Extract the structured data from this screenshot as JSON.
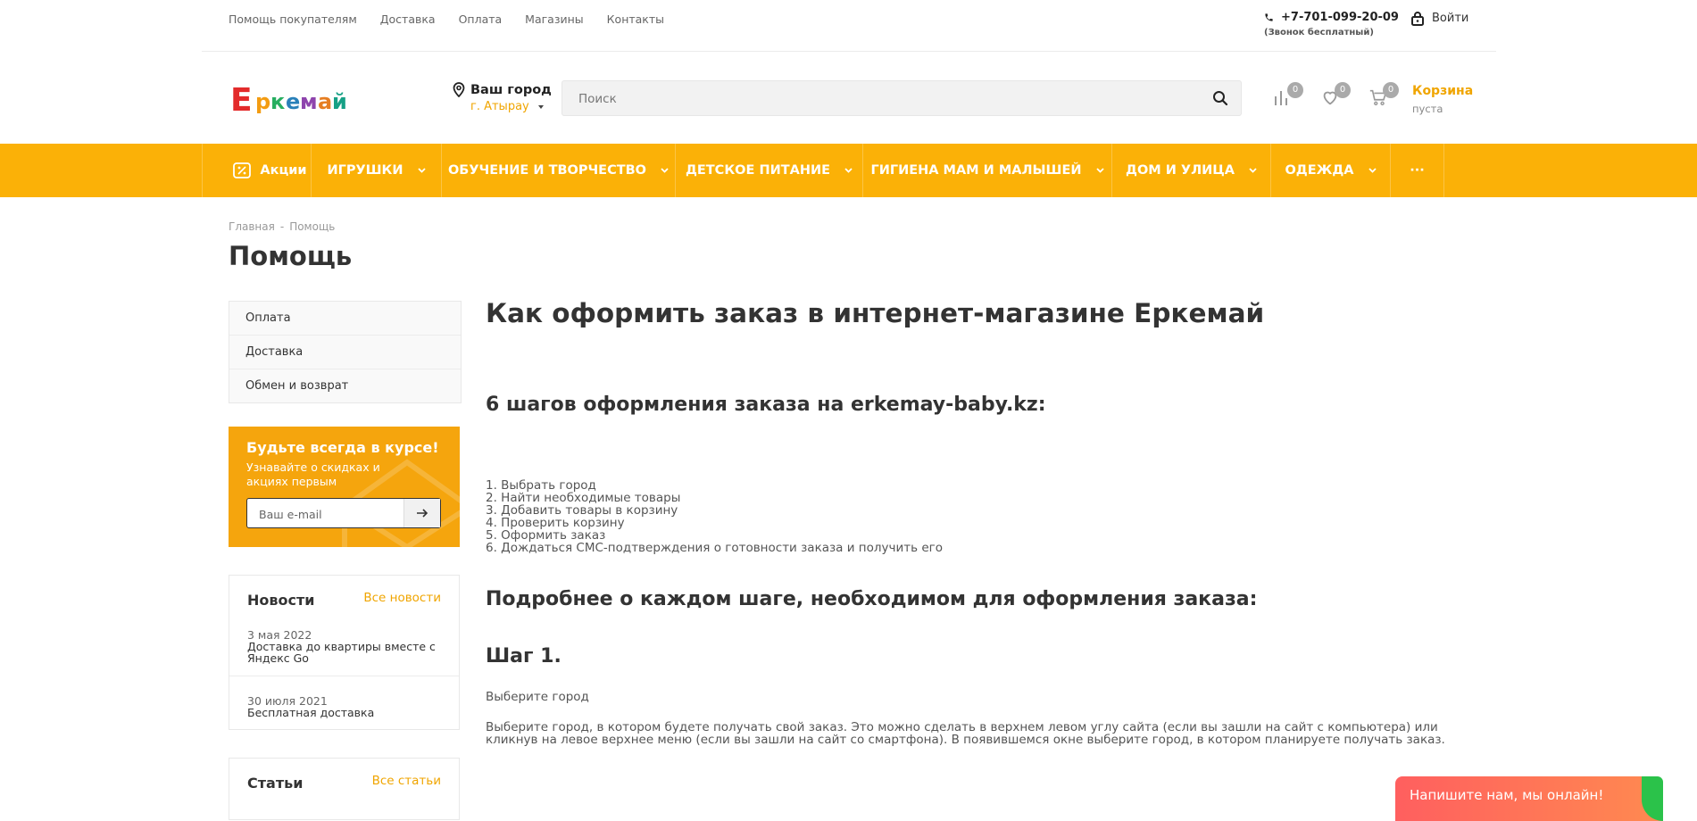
{
  "topbar": {
    "links": [
      "Помощь покупателям",
      "Доставка",
      "Оплата",
      "Магазины",
      "Контакты"
    ],
    "phone": "+7-701-099-20-09",
    "phone_note": "(Звонок бесплатный)",
    "login": "Войти"
  },
  "header": {
    "logo_text": "Еркемай",
    "city_label": "Ваш город",
    "city_value": "г. Атырау",
    "search_placeholder": "Поиск",
    "compare_count": "0",
    "favorites_count": "0",
    "cart_count": "0",
    "cart_title": "Корзина",
    "cart_status": "пуста"
  },
  "nav": {
    "items": [
      "Акции",
      "ИГРУШКИ",
      "ОБУЧЕНИЕ И ТВОРЧЕСТВО",
      "ДЕТСКОЕ ПИТАНИЕ",
      "ГИГИЕНА МАМ И МАЛЫШЕЙ",
      "ДОМ И УЛИЦА",
      "ОДЕЖДА"
    ],
    "more": "···"
  },
  "breadcrumb": {
    "home": "Главная",
    "separator": "-",
    "current": "Помощь"
  },
  "page_title": "Помощь",
  "sidebar": {
    "menu": [
      "Оплата",
      "Доставка",
      "Обмен и возврат"
    ],
    "subscribe": {
      "title": "Будьте всегда в курсе!",
      "text": "Узнавайте о скидках и акциях первым",
      "placeholder": "Ваш e-mail"
    },
    "news": {
      "title": "Новости",
      "all_link": "Все новости",
      "items": [
        {
          "date": "3 мая 2022",
          "title": "Доставка до квартиры вместе с Яндекс Go"
        },
        {
          "date": "30 июля 2021",
          "title": "Бесплатная доставка"
        }
      ]
    },
    "articles": {
      "title": "Статьи",
      "all_link": "Все статьи"
    }
  },
  "content": {
    "heading": "Как оформить заказ в интернет-магазине Еркемай",
    "steps_heading": "6 шагов оформления заказа на erkemay-baby.kz:",
    "steps": [
      "1. Выбрать город",
      "2. Найти необходимые товары",
      "3. Добавить товары в корзину",
      "4. Проверить корзину",
      "5. Оформить заказ",
      "6. Дождаться СМС-подтверждения о готовности заказа и получить его"
    ],
    "details_heading": "Подробнее о каждом шаге, необходимом для оформления заказа:",
    "step1_heading": "Шаг 1.",
    "step1_sub": "Выберите город",
    "step1_text": "Выберите город, в котором будете получать свой заказ. Это можно сделать в верхнем левом углу сайта (если вы зашли на сайт с компьютера) или кликнув на левое верхнее меню (если вы зашли на сайт со смартфона). В появившемся окне выберите город, в котором планируете получать заказ."
  },
  "chat": {
    "label": "Напишите нам, мы онлайн!"
  },
  "colors": {
    "accent": "#fbb107",
    "link": "#f0a500",
    "chat": "#ff6b5a"
  }
}
